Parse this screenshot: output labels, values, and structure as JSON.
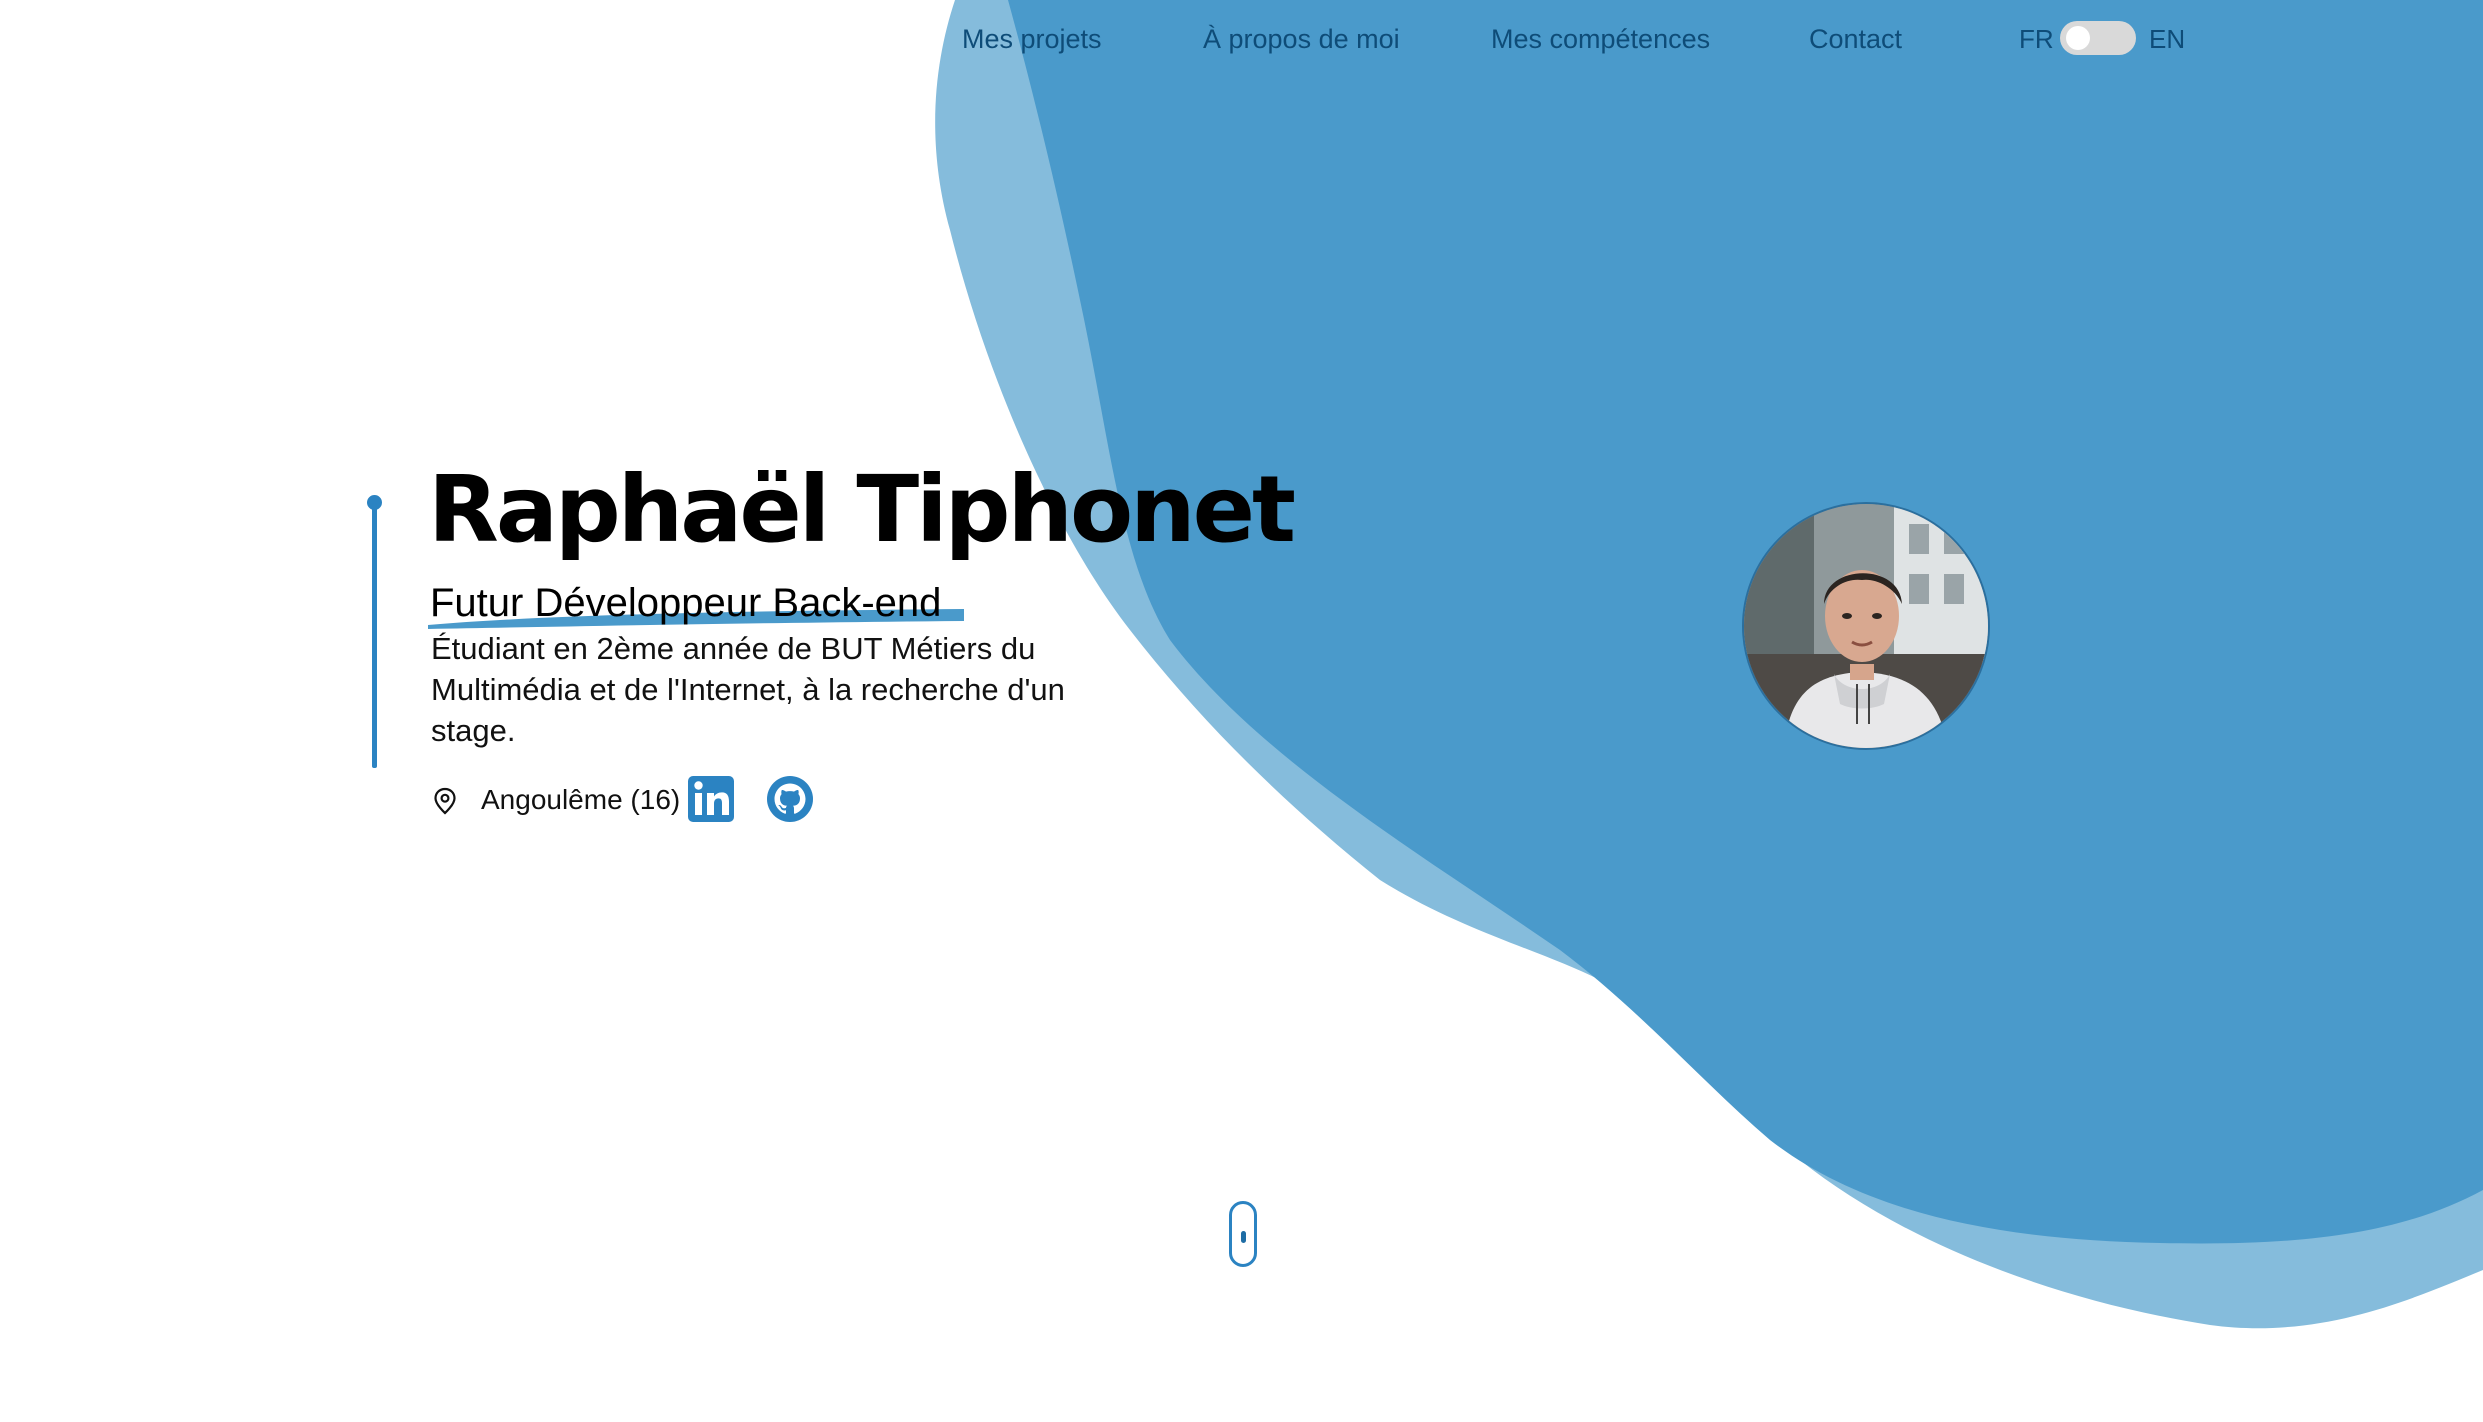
{
  "nav": {
    "links": [
      {
        "label": "Mes projets"
      },
      {
        "label": "À propos de moi"
      },
      {
        "label": "Mes compétences"
      },
      {
        "label": "Contact"
      }
    ],
    "lang_left": "FR",
    "lang_right": "EN",
    "lang_toggle_state": "FR"
  },
  "hero": {
    "name": "Raphaël Tiphonet",
    "subtitle": "Futur Développeur Back-end",
    "description": "Étudiant en 2ème année de BUT Métiers du Multimédia et de l'Internet, à la recherche d'un stage.",
    "location": "Angoulême (16)",
    "icons": {
      "location": "map-pin-icon",
      "linkedin": "linkedin-icon",
      "github": "github-icon",
      "scroll": "mouse-scroll-icon"
    }
  },
  "colors": {
    "blob_dark": "#4a9acb",
    "blob_light": "#85bcdc",
    "accent": "#2b83c2",
    "nav_text": "#0e4c78"
  }
}
